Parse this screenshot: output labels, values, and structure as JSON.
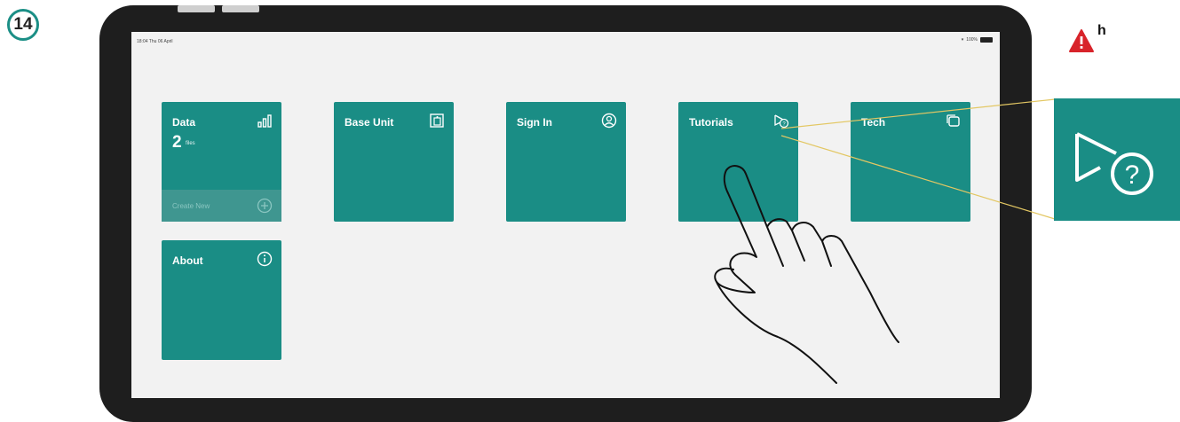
{
  "step": {
    "number": "14"
  },
  "status_bar": {
    "time": "18:04 Thu 06 April",
    "battery": "100%"
  },
  "tiles": [
    {
      "label": "Data",
      "icon": "bar-chart-icon",
      "count": "2",
      "count_unit": "files",
      "create_label": "Create New",
      "create_icon": "add-circle-icon"
    },
    {
      "label": "Base Unit",
      "icon": "base-unit-icon"
    },
    {
      "label": "Sign In",
      "icon": "user-circle-icon"
    },
    {
      "label": "Tutorials",
      "icon": "tutorial-help-icon"
    },
    {
      "label": "Tech",
      "icon": "tech-device-icon"
    },
    {
      "label": "About",
      "icon": "info-circle-icon"
    }
  ],
  "callout": {
    "icon": "tutorial-help-icon"
  },
  "warning": {
    "icon": "warning-icon",
    "label": "h"
  },
  "colors": {
    "tile": "#1a8d85",
    "screen_bg": "#f2f2f2",
    "bezel": "#1e1e1e",
    "leader_line": "#e3c763",
    "warning": "#d8232a"
  },
  "gesture": {
    "icon": "tap-hand-icon"
  }
}
